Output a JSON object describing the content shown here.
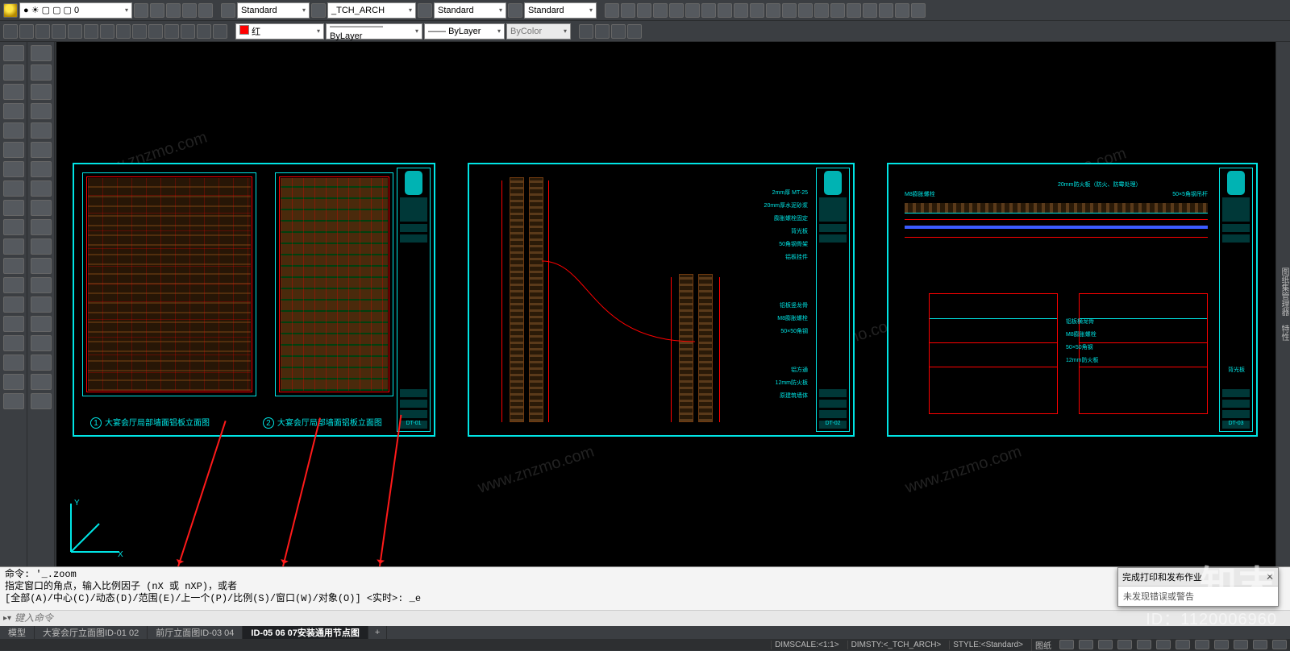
{
  "topbar": {
    "layer_selector": "● ☀ ▢ ▢ ▢ 0",
    "text_style_1": "Standard",
    "dim_style": "_TCH_ARCH",
    "text_style_2": "Standard",
    "table_style": "Standard"
  },
  "propbar": {
    "color": "红",
    "linetype": "ByLayer",
    "lineweight": "ByLayer",
    "plotstyle": "ByColor"
  },
  "sheets": {
    "s1": {
      "caption_a": "大宴会厅局部墙面铝板立面图",
      "caption_b": "大宴会厅局部墙面铝板立面图",
      "num_a": "1",
      "num_b": "2",
      "code": "DT-01"
    },
    "s2": {
      "code": "DT-02"
    },
    "s3": {
      "code": "DT-03"
    }
  },
  "right_panel": {
    "label_1": "图纸集管理器",
    "label_2": "特性"
  },
  "command": {
    "hist_1": "命令: '_.zoom",
    "hist_2": "指定窗口的角点，输入比例因子 (nX 或 nXP)，或者",
    "hist_3": "[全部(A)/中心(C)/动态(D)/范围(E)/上一个(P)/比例(S)/窗口(W)/对象(O)] <实时>: _e",
    "placeholder": "键入命令"
  },
  "tabs": {
    "model": "模型",
    "t1": "大宴会厅立面图ID-01 02",
    "t2": "前厅立面图ID-03 04",
    "t3": "ID-05 06 07安装通用节点图",
    "add": "+"
  },
  "status": {
    "dimscale": "DIMSCALE:<1:1>",
    "dimsty": "DIMSTY:<_TCH_ARCH>",
    "style": "STYLE:<Standard>",
    "paper": "图纸"
  },
  "popup": {
    "title": "完成打印和发布作业",
    "body": "未发现错误或警告"
  },
  "watermark": {
    "brand": "知末",
    "id": "ID：1120006960",
    "url": "www.znzmo.com"
  }
}
